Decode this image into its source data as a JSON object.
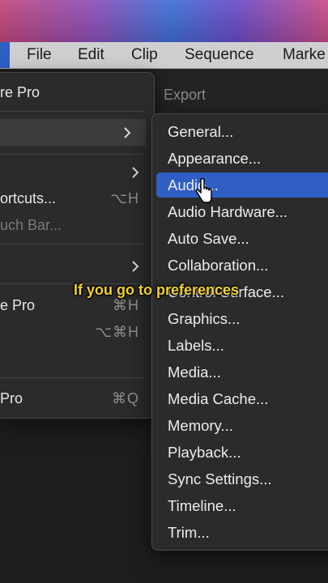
{
  "menubar": {
    "items": [
      {
        "label": "File"
      },
      {
        "label": "Edit"
      },
      {
        "label": "Clip"
      },
      {
        "label": "Sequence"
      },
      {
        "label": "Marke"
      }
    ]
  },
  "panel": {
    "export_label": "Export"
  },
  "app_menu": {
    "items": [
      {
        "label": "re Pro"
      },
      {
        "label": ""
      },
      {
        "label": ""
      },
      {
        "label": "ortcuts...",
        "shortcut": "⌥H"
      },
      {
        "label": "uch Bar..."
      },
      {
        "label": ""
      },
      {
        "label": "e Pro",
        "shortcut": "⌘H"
      },
      {
        "label": "",
        "shortcut": "⌥⌘H"
      },
      {
        "label": ""
      },
      {
        "label": " Pro",
        "shortcut": "⌘Q"
      }
    ]
  },
  "preferences_menu": {
    "items": [
      {
        "label": "General..."
      },
      {
        "label": "Appearance..."
      },
      {
        "label": "Audio..."
      },
      {
        "label": "Audio Hardware..."
      },
      {
        "label": "Auto Save..."
      },
      {
        "label": "Collaboration..."
      },
      {
        "label": "Control Surface..."
      },
      {
        "label": "Graphics..."
      },
      {
        "label": "Labels..."
      },
      {
        "label": "Media..."
      },
      {
        "label": "Media Cache..."
      },
      {
        "label": "Memory..."
      },
      {
        "label": "Playback..."
      },
      {
        "label": "Sync Settings..."
      },
      {
        "label": "Timeline..."
      },
      {
        "label": "Trim..."
      }
    ],
    "selected_index": 2
  },
  "caption": {
    "text": "If you go to preferences"
  },
  "colors": {
    "selection": "#2f5fc4",
    "caption": "#f2d12b"
  }
}
